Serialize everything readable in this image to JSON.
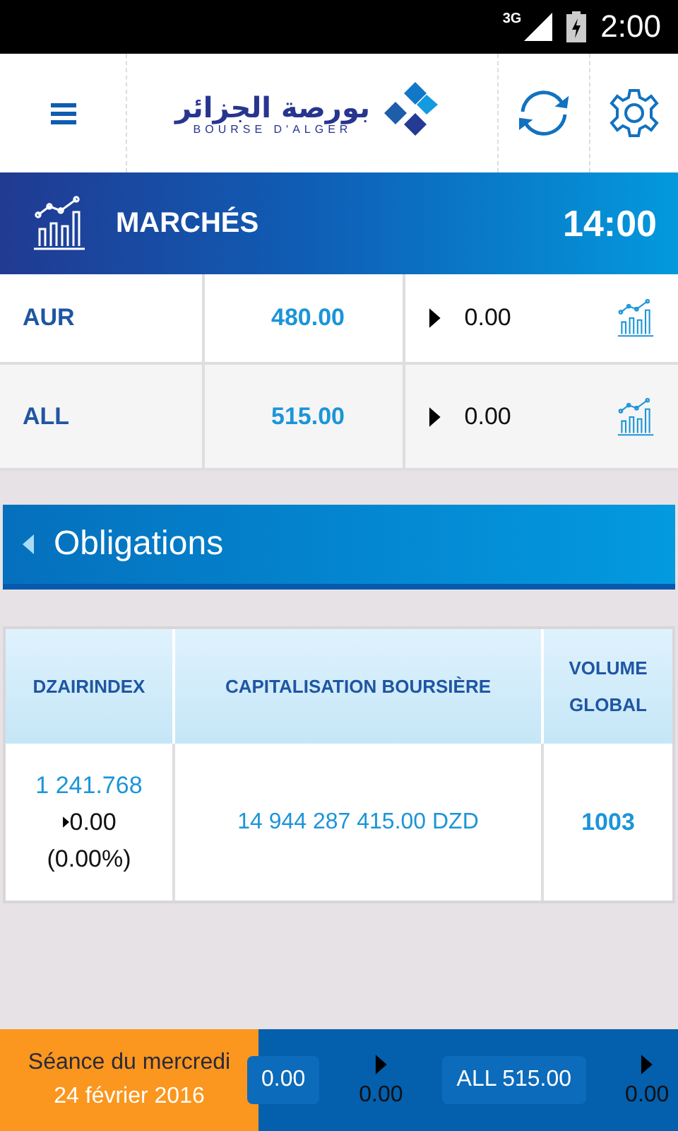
{
  "status_bar": {
    "network": "3G",
    "time": "2:00"
  },
  "header": {
    "logo_arabic": "بورصة الجزائر",
    "logo_latin": "BOURSE D'ALGER"
  },
  "markets": {
    "title": "MARCHÉS",
    "time": "14:00",
    "rows": [
      {
        "symbol": "AUR",
        "price": "480.00",
        "change": "0.00"
      },
      {
        "symbol": "ALL",
        "price": "515.00",
        "change": "0.00"
      }
    ]
  },
  "section": {
    "title": "Obligations"
  },
  "index_table": {
    "columns": [
      "DZAIRINDEX",
      "CAPITALISATION BOURSIÈRE",
      "VOLUME GLOBAL"
    ],
    "row": {
      "index_value": "1 241.768",
      "index_change": "0.00",
      "index_percent": "(0.00%)",
      "capitalisation": "14 944 287 415.00 DZD",
      "volume": "1003"
    }
  },
  "ticker": {
    "session_label": "Séance du mercredi",
    "session_date": "24 février 2016",
    "items": [
      {
        "quote": "0.00",
        "change": "0.00"
      },
      {
        "quote": "ALL 515.00",
        "change": "0.00"
      }
    ]
  }
}
